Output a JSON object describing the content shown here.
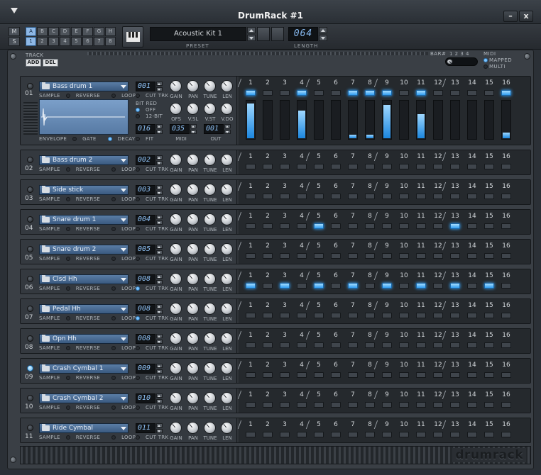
{
  "window": {
    "title": "DrumRack #1",
    "minimize": "–",
    "close": "x"
  },
  "toolbar": {
    "m_label": "M",
    "s_label": "S",
    "patterns_top": [
      "A",
      "B",
      "C",
      "D",
      "E",
      "F",
      "G",
      "H"
    ],
    "patterns_bottom": [
      "1",
      "2",
      "3",
      "4",
      "5",
      "6",
      "7",
      "8"
    ],
    "active_pattern_top": "A",
    "active_pattern_bottom": "1",
    "preset_value": "Acoustic Kit 1",
    "preset_label": "PRESET",
    "length_value": "064",
    "length_label": "LENGTH"
  },
  "header": {
    "track_label": "TRACK",
    "add_label": "ADD",
    "del_label": "DEL",
    "bar_label": "BAR#",
    "bar_numbers": "1 2 3 4",
    "midi_label": "MIDI",
    "mapped_label": "MAPPED",
    "multi_label": "MULTI"
  },
  "labels": {
    "sample": "SAMPLE",
    "reverse": "REVERSE",
    "loop": "LOOP",
    "cut_trk": "CUT TRK",
    "gain": "GAIN",
    "pan": "PAN",
    "tune": "TUNE",
    "len": "LEN",
    "bit_red": "BIT RED",
    "off": "OFF",
    "bit12": "12-BIT",
    "ofs": "OFS",
    "vsl": "V.SL",
    "vst": "V.ST",
    "vdo": "V.DO",
    "envelope": "ENVELOPE",
    "gate": "GATE",
    "decay": "DECAY",
    "fit": "FIT",
    "midi": "MIDI",
    "out": "OUT",
    "expanded_bottom_values": [
      "016",
      "035",
      "001"
    ]
  },
  "steps": [
    "1",
    "2",
    "3",
    "4",
    "5",
    "6",
    "7",
    "8",
    "9",
    "10",
    "11",
    "12",
    "13",
    "14",
    "15",
    "16"
  ],
  "tracks": [
    {
      "num": "01",
      "name": "Bass drum 1",
      "cut": "001",
      "led": false,
      "cut_on": false,
      "active": [
        1,
        4,
        7,
        8,
        9,
        11,
        16
      ],
      "velocity": [
        0,
        0.95,
        0,
        0,
        0.75,
        0,
        0,
        0.1,
        0.1,
        0.9,
        0,
        0.65,
        0,
        0,
        0,
        0,
        0.15
      ]
    },
    {
      "num": "02",
      "name": "Bass drum 2",
      "cut": "002",
      "led": false,
      "cut_on": false,
      "active": []
    },
    {
      "num": "03",
      "name": "Side stick",
      "cut": "003",
      "led": false,
      "cut_on": false,
      "active": []
    },
    {
      "num": "04",
      "name": "Snare drum 1",
      "cut": "004",
      "led": false,
      "cut_on": false,
      "active": [
        5,
        13
      ]
    },
    {
      "num": "05",
      "name": "Snare drum 2",
      "cut": "005",
      "led": false,
      "cut_on": false,
      "active": []
    },
    {
      "num": "06",
      "name": "Clsd Hh",
      "cut": "008",
      "led": false,
      "cut_on": true,
      "active": [
        1,
        3,
        5,
        7,
        9,
        11,
        13,
        15
      ]
    },
    {
      "num": "07",
      "name": "Pedal Hh",
      "cut": "008",
      "led": false,
      "cut_on": true,
      "active": []
    },
    {
      "num": "08",
      "name": "Opn Hh",
      "cut": "008",
      "led": false,
      "cut_on": false,
      "active": []
    },
    {
      "num": "09",
      "name": "Crash Cymbal 1",
      "cut": "009",
      "led": true,
      "cut_on": false,
      "active": []
    },
    {
      "num": "10",
      "name": "Crash Cymbal 2",
      "cut": "010",
      "led": false,
      "cut_on": false,
      "active": []
    },
    {
      "num": "11",
      "name": "Ride Cymbal",
      "cut": "011",
      "led": false,
      "cut_on": false,
      "active": []
    }
  ],
  "footer": {
    "brand": "drumrack"
  }
}
